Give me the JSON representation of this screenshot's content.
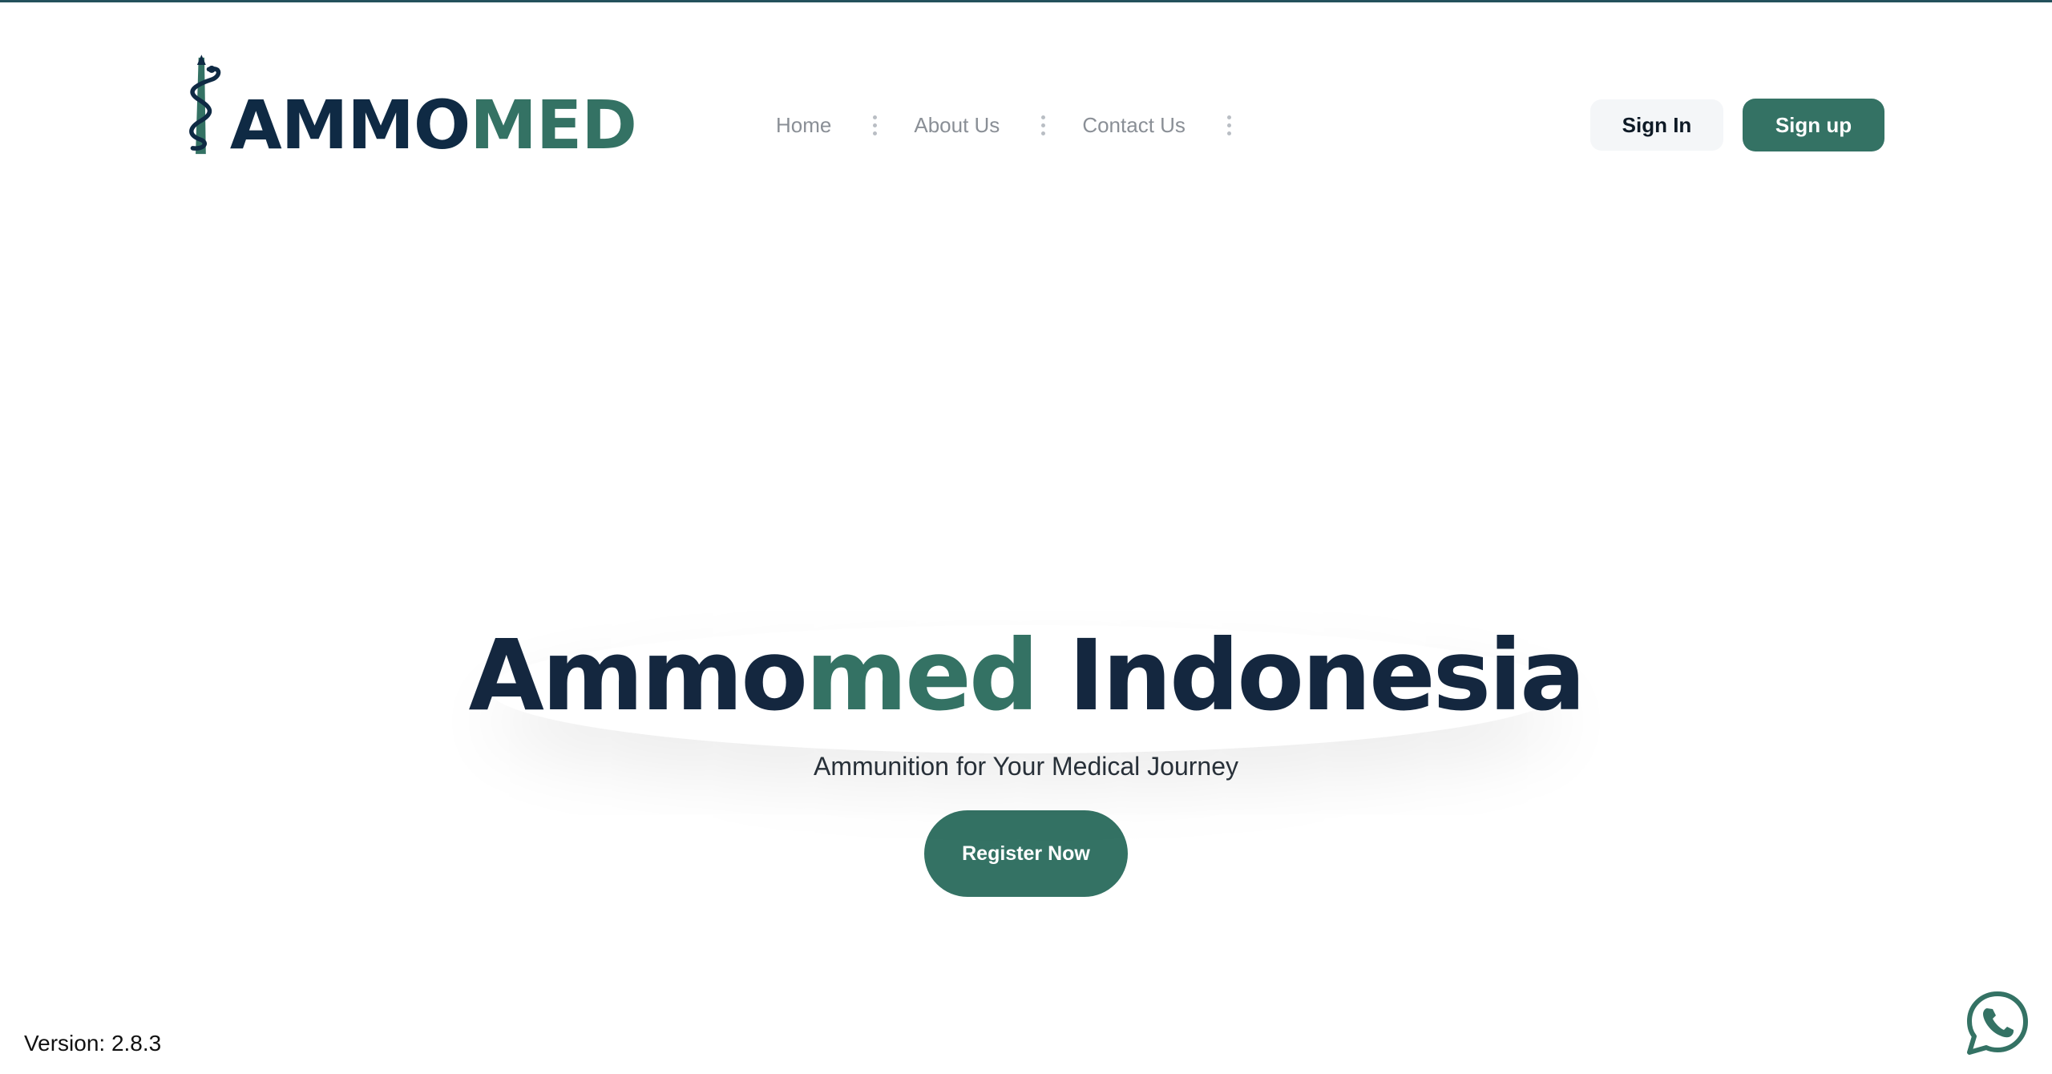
{
  "brand": {
    "logo_dark": "AMMO",
    "logo_green": "MED",
    "colors": {
      "dark": "#0f2a44",
      "green": "#347264"
    }
  },
  "nav": {
    "items": [
      {
        "label": "Home"
      },
      {
        "label": "About Us"
      },
      {
        "label": "Contact Us"
      }
    ]
  },
  "auth": {
    "signin_label": "Sign In",
    "signup_label": "Sign up"
  },
  "hero": {
    "title_part1": "Ammo",
    "title_part2": "med",
    "title_part3": " Indonesia",
    "subtitle": "Ammunition for Your Medical Journey",
    "cta_label": "Register Now"
  },
  "footer": {
    "version": "Version: 2.8.3"
  },
  "icons": {
    "logo_icon": "rod-of-asclepius-icon",
    "whatsapp": "whatsapp-icon"
  }
}
